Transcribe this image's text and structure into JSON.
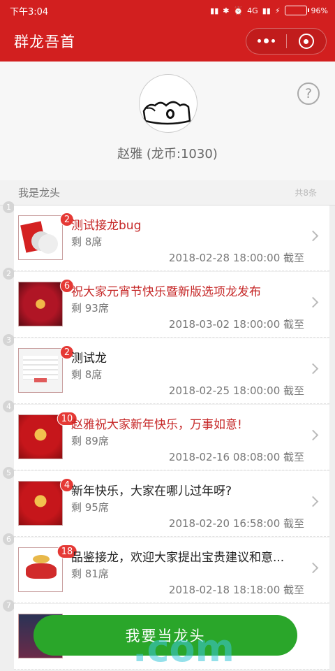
{
  "status": {
    "time": "下午3:04",
    "network": "4G",
    "battery": "96%"
  },
  "header": {
    "title": "群龙吾首"
  },
  "profile": {
    "name": "赵雅 (龙币:1030)",
    "help": "?"
  },
  "section": {
    "label": "我是龙头",
    "count": "共8条"
  },
  "items": [
    {
      "num": "1",
      "badge": "2",
      "title": "测试接龙bug",
      "title_color": "red",
      "seats": "剩 8席",
      "deadline": "2018-02-28 18:00:00 截至",
      "thumb": "fu"
    },
    {
      "num": "2",
      "badge": "6",
      "title": "祝大家元宵节快乐暨新版选项龙发布",
      "title_color": "red",
      "seats": "剩 93席",
      "deadline": "2018-03-02 18:00:00 截至",
      "thumb": "pink"
    },
    {
      "num": "3",
      "badge": "2",
      "title": "测试龙",
      "title_color": "black",
      "seats": "剩 8席",
      "deadline": "2018-02-25 18:00:00 截至",
      "thumb": "doc"
    },
    {
      "num": "4",
      "badge": "10",
      "title": "赵雅祝大家新年快乐，万事如意!",
      "title_color": "red",
      "seats": "剩 89席",
      "deadline": "2018-02-16 08:08:00 截至",
      "thumb": "red"
    },
    {
      "num": "5",
      "badge": "4",
      "title": "新年快乐，大家在哪儿过年呀?",
      "title_color": "black",
      "seats": "剩 95席",
      "deadline": "2018-02-20 16:58:00 截至",
      "thumb": "red"
    },
    {
      "num": "6",
      "badge": "18",
      "title": "品鉴接龙，欢迎大家提出宝贵建议和意...",
      "title_color": "black",
      "seats": "剩 81席",
      "deadline": "2018-02-18 18:18:00 截至",
      "thumb": "white2018"
    },
    {
      "num": "7",
      "badge": "",
      "title": "",
      "title_color": "black",
      "seats": "",
      "deadline": "",
      "thumb": "dark"
    }
  ],
  "cta": {
    "label": "我要当龙头"
  },
  "colors": {
    "primary": "#d21f1f",
    "accent_green": "#2aa62a",
    "badge": "#e53935"
  }
}
